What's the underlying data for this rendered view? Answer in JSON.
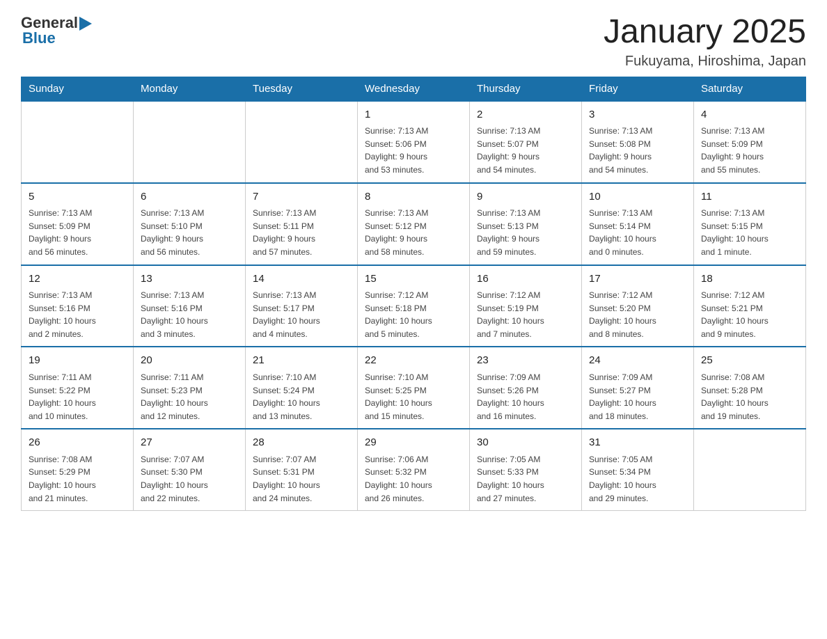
{
  "header": {
    "logo_general": "General",
    "logo_blue": "Blue",
    "title": "January 2025",
    "subtitle": "Fukuyama, Hiroshima, Japan"
  },
  "days_of_week": [
    "Sunday",
    "Monday",
    "Tuesday",
    "Wednesday",
    "Thursday",
    "Friday",
    "Saturday"
  ],
  "weeks": [
    [
      {
        "day": "",
        "info": ""
      },
      {
        "day": "",
        "info": ""
      },
      {
        "day": "",
        "info": ""
      },
      {
        "day": "1",
        "info": "Sunrise: 7:13 AM\nSunset: 5:06 PM\nDaylight: 9 hours\nand 53 minutes."
      },
      {
        "day": "2",
        "info": "Sunrise: 7:13 AM\nSunset: 5:07 PM\nDaylight: 9 hours\nand 54 minutes."
      },
      {
        "day": "3",
        "info": "Sunrise: 7:13 AM\nSunset: 5:08 PM\nDaylight: 9 hours\nand 54 minutes."
      },
      {
        "day": "4",
        "info": "Sunrise: 7:13 AM\nSunset: 5:09 PM\nDaylight: 9 hours\nand 55 minutes."
      }
    ],
    [
      {
        "day": "5",
        "info": "Sunrise: 7:13 AM\nSunset: 5:09 PM\nDaylight: 9 hours\nand 56 minutes."
      },
      {
        "day": "6",
        "info": "Sunrise: 7:13 AM\nSunset: 5:10 PM\nDaylight: 9 hours\nand 56 minutes."
      },
      {
        "day": "7",
        "info": "Sunrise: 7:13 AM\nSunset: 5:11 PM\nDaylight: 9 hours\nand 57 minutes."
      },
      {
        "day": "8",
        "info": "Sunrise: 7:13 AM\nSunset: 5:12 PM\nDaylight: 9 hours\nand 58 minutes."
      },
      {
        "day": "9",
        "info": "Sunrise: 7:13 AM\nSunset: 5:13 PM\nDaylight: 9 hours\nand 59 minutes."
      },
      {
        "day": "10",
        "info": "Sunrise: 7:13 AM\nSunset: 5:14 PM\nDaylight: 10 hours\nand 0 minutes."
      },
      {
        "day": "11",
        "info": "Sunrise: 7:13 AM\nSunset: 5:15 PM\nDaylight: 10 hours\nand 1 minute."
      }
    ],
    [
      {
        "day": "12",
        "info": "Sunrise: 7:13 AM\nSunset: 5:16 PM\nDaylight: 10 hours\nand 2 minutes."
      },
      {
        "day": "13",
        "info": "Sunrise: 7:13 AM\nSunset: 5:16 PM\nDaylight: 10 hours\nand 3 minutes."
      },
      {
        "day": "14",
        "info": "Sunrise: 7:13 AM\nSunset: 5:17 PM\nDaylight: 10 hours\nand 4 minutes."
      },
      {
        "day": "15",
        "info": "Sunrise: 7:12 AM\nSunset: 5:18 PM\nDaylight: 10 hours\nand 5 minutes."
      },
      {
        "day": "16",
        "info": "Sunrise: 7:12 AM\nSunset: 5:19 PM\nDaylight: 10 hours\nand 7 minutes."
      },
      {
        "day": "17",
        "info": "Sunrise: 7:12 AM\nSunset: 5:20 PM\nDaylight: 10 hours\nand 8 minutes."
      },
      {
        "day": "18",
        "info": "Sunrise: 7:12 AM\nSunset: 5:21 PM\nDaylight: 10 hours\nand 9 minutes."
      }
    ],
    [
      {
        "day": "19",
        "info": "Sunrise: 7:11 AM\nSunset: 5:22 PM\nDaylight: 10 hours\nand 10 minutes."
      },
      {
        "day": "20",
        "info": "Sunrise: 7:11 AM\nSunset: 5:23 PM\nDaylight: 10 hours\nand 12 minutes."
      },
      {
        "day": "21",
        "info": "Sunrise: 7:10 AM\nSunset: 5:24 PM\nDaylight: 10 hours\nand 13 minutes."
      },
      {
        "day": "22",
        "info": "Sunrise: 7:10 AM\nSunset: 5:25 PM\nDaylight: 10 hours\nand 15 minutes."
      },
      {
        "day": "23",
        "info": "Sunrise: 7:09 AM\nSunset: 5:26 PM\nDaylight: 10 hours\nand 16 minutes."
      },
      {
        "day": "24",
        "info": "Sunrise: 7:09 AM\nSunset: 5:27 PM\nDaylight: 10 hours\nand 18 minutes."
      },
      {
        "day": "25",
        "info": "Sunrise: 7:08 AM\nSunset: 5:28 PM\nDaylight: 10 hours\nand 19 minutes."
      }
    ],
    [
      {
        "day": "26",
        "info": "Sunrise: 7:08 AM\nSunset: 5:29 PM\nDaylight: 10 hours\nand 21 minutes."
      },
      {
        "day": "27",
        "info": "Sunrise: 7:07 AM\nSunset: 5:30 PM\nDaylight: 10 hours\nand 22 minutes."
      },
      {
        "day": "28",
        "info": "Sunrise: 7:07 AM\nSunset: 5:31 PM\nDaylight: 10 hours\nand 24 minutes."
      },
      {
        "day": "29",
        "info": "Sunrise: 7:06 AM\nSunset: 5:32 PM\nDaylight: 10 hours\nand 26 minutes."
      },
      {
        "day": "30",
        "info": "Sunrise: 7:05 AM\nSunset: 5:33 PM\nDaylight: 10 hours\nand 27 minutes."
      },
      {
        "day": "31",
        "info": "Sunrise: 7:05 AM\nSunset: 5:34 PM\nDaylight: 10 hours\nand 29 minutes."
      },
      {
        "day": "",
        "info": ""
      }
    ]
  ]
}
